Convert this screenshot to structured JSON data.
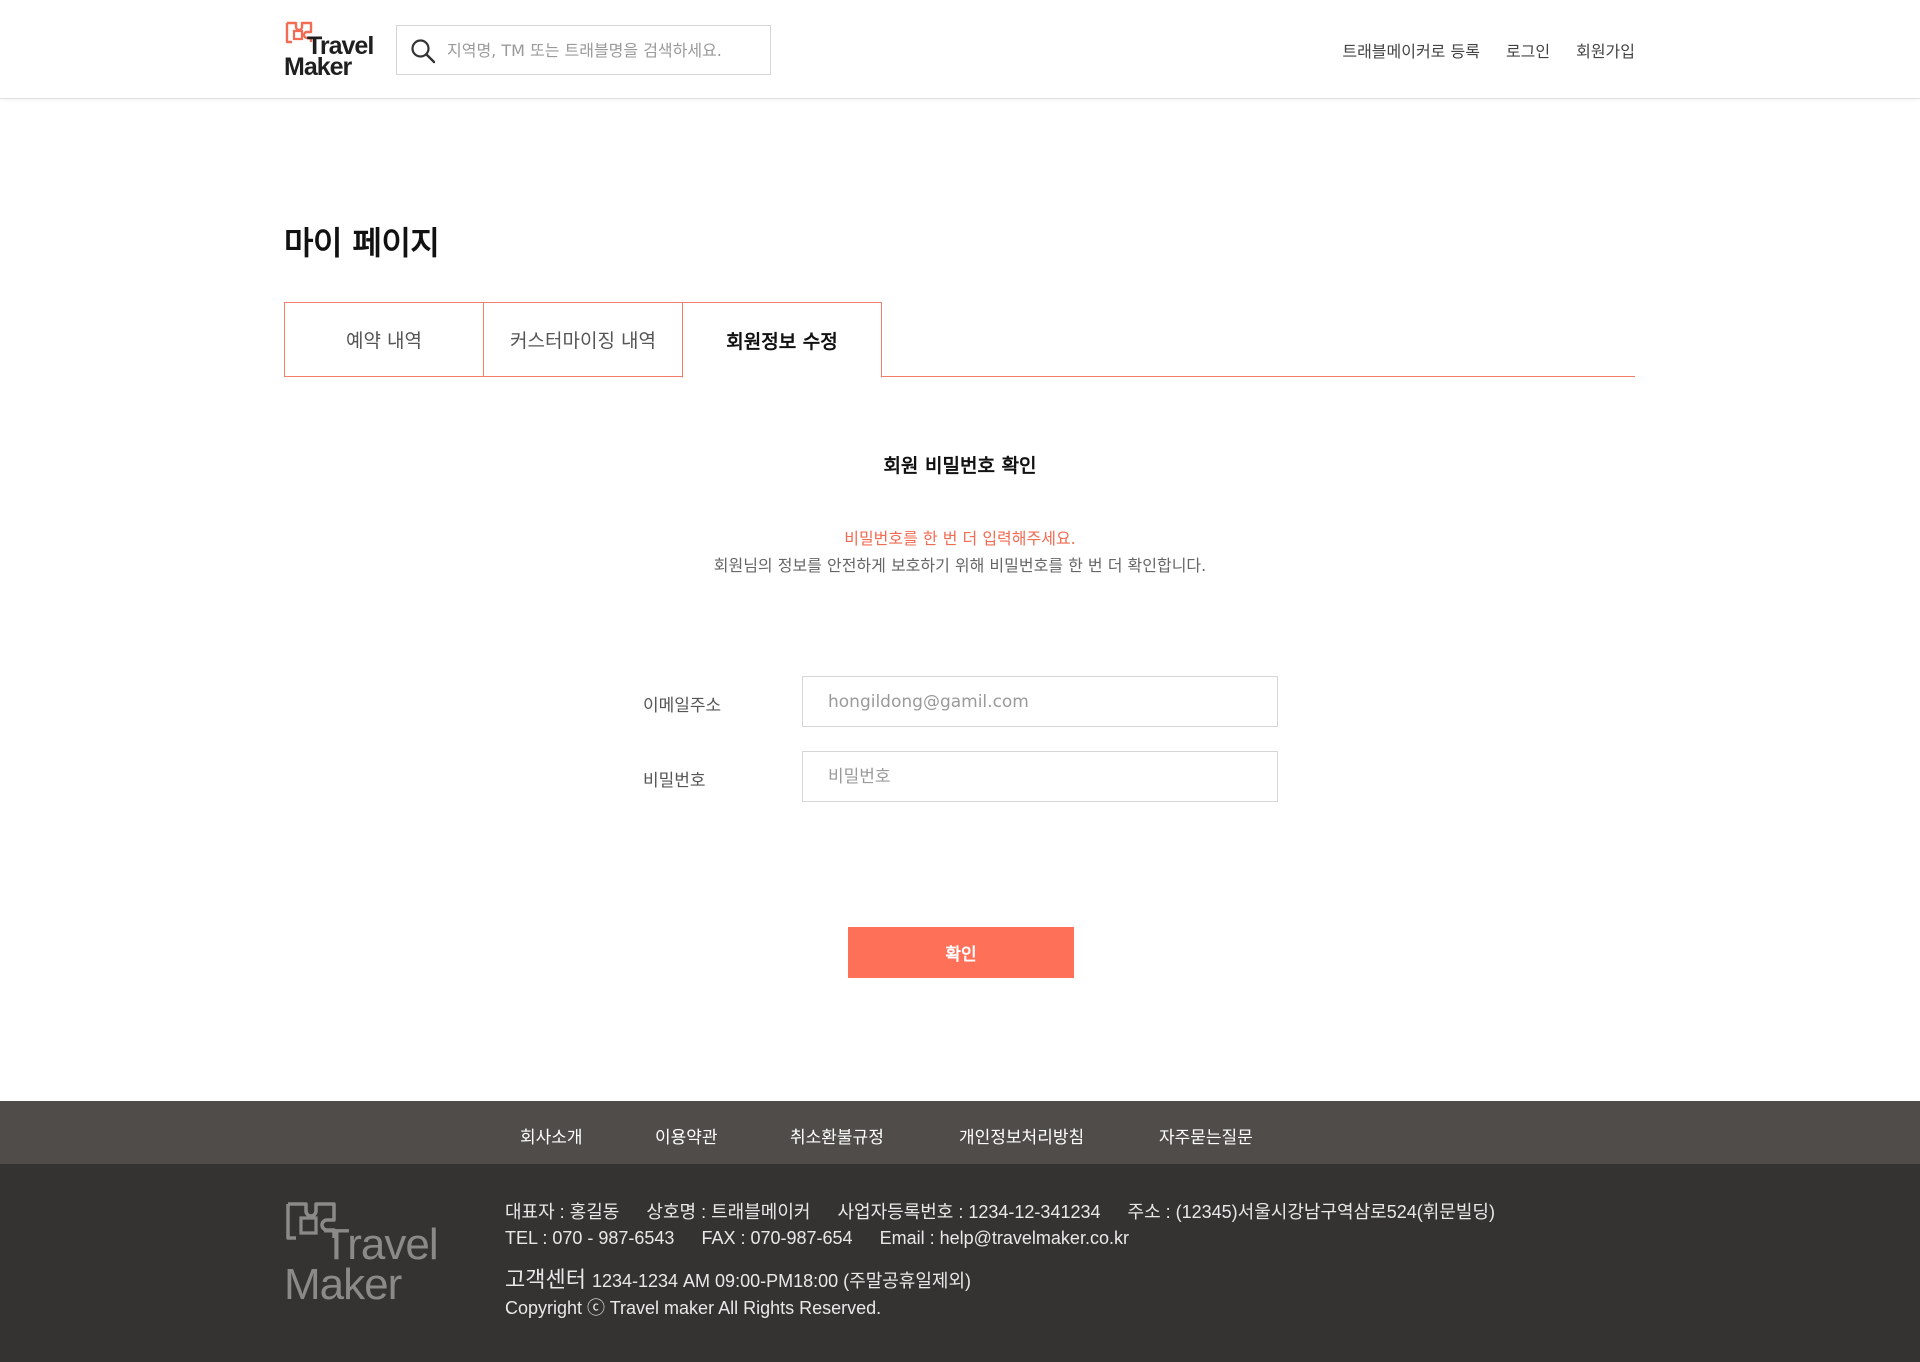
{
  "header": {
    "logo": {
      "line1": "Travel",
      "line2": "Maker"
    },
    "search": {
      "placeholder": "지역명, TM 또는 트래블명을 검색하세요."
    },
    "nav": {
      "register_as_maker": "트래블메이커로 등록",
      "login": "로그인",
      "signup": "회원가입"
    }
  },
  "main": {
    "page_title": "마이 페이지",
    "tabs": [
      {
        "label": "예약 내역",
        "active": false
      },
      {
        "label": "커스터마이징 내역",
        "active": false
      },
      {
        "label": "회원정보 수정",
        "active": true
      }
    ],
    "section_title": "회원 비밀번호 확인",
    "notice_red": "비밀번호를 한 번 더 입력해주세요.",
    "notice_gray": "회원님의 정보를 안전하게 보호하기 위해 비밀번호를 한 번 더 확인합니다.",
    "form": {
      "email_label": "이메일주소",
      "email_placeholder": "hongildong@gamil.com",
      "password_label": "비밀번호",
      "password_placeholder": "비밀번호"
    },
    "confirm_label": "확인"
  },
  "footer": {
    "nav": [
      "회사소개",
      "이용약관",
      "취소환불규정",
      "개인정보처리방침",
      "자주묻는질문"
    ],
    "logo": {
      "line1": "Travel",
      "line2": "Maker"
    },
    "ceo": "대표자 : 홍길동",
    "company": "상호명 : 트래블메이커",
    "biz_no": "사업자등록번호 : 1234-12-341234",
    "address": "주소 : (12345)서울시강남구역삼로524(휘문빌딩)",
    "tel": "TEL : 070 - 987-6543",
    "fax": "FAX : 070-987-654",
    "email": "Email : help@travelmaker.co.kr",
    "cs_title": "고객센터",
    "cs_info": "1234-1234   AM 09:00-PM18:00 (주말공휴일제외)",
    "copyright": "Copyright ⓒ Travel maker All Rights Reserved."
  },
  "colors": {
    "accent": "#ff7058",
    "tab_border": "#f47c6c",
    "notice_red": "#f26b52",
    "footer_nav_bg": "#4f4c4a",
    "footer_bg": "#353331"
  }
}
